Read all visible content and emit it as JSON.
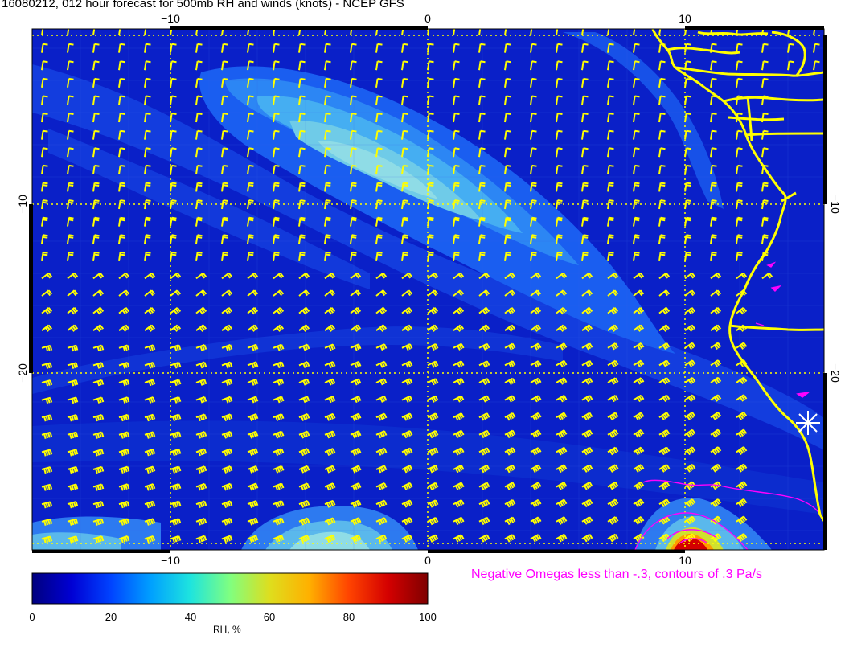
{
  "title": "16080212, 012 hour forecast for 500mb RH and winds (knots) - NCEP GFS",
  "axes": {
    "lon_ticks": [
      "−10",
      "0",
      "10"
    ],
    "lat_ticks": [
      "−10",
      "−20"
    ]
  },
  "map": {
    "lon_range": [
      -15.5,
      15.5
    ],
    "lat_range": [
      -29.5,
      0.2
    ],
    "grid": "dotted graticule every 10 degrees",
    "field": "500mb RH filled contours",
    "coastline_color": "#ffff00",
    "barb_color": "#ffff00",
    "omega_contour_color": "#ff00ff",
    "station_marker": "white star near 15E, 22.7S"
  },
  "omega_note": "Negative Omegas less than -.3, contours of .3 Pa/s",
  "colorbar": {
    "title": "RH, %",
    "ticks": [
      "0",
      "20",
      "40",
      "60",
      "80",
      "100"
    ],
    "range": [
      0,
      100
    ],
    "colors": [
      "#00007f",
      "#0000d4",
      "#0044ff",
      "#00a0ff",
      "#1ee4de",
      "#80ff80",
      "#dede1e",
      "#ffb000",
      "#ff4400",
      "#d40000",
      "#7f0000"
    ]
  }
}
